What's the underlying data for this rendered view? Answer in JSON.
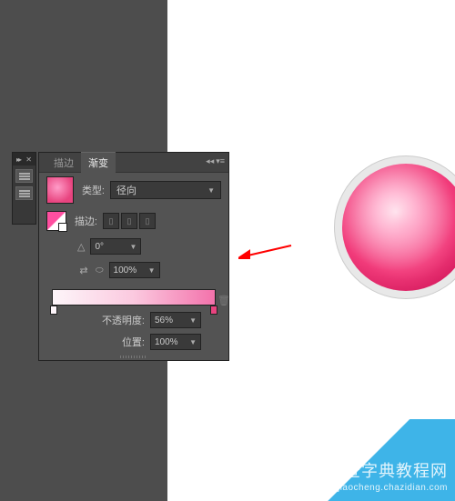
{
  "panel": {
    "tabs": {
      "stroke": "描边",
      "gradient": "渐变"
    },
    "type_label": "类型:",
    "type_value": "径向",
    "stroke_label": "描边:",
    "angle_value": "0°",
    "ratio_value": "100%",
    "opacity_label": "不透明度:",
    "opacity_value": "56%",
    "position_label": "位置:",
    "position_value": "100%"
  },
  "watermark": {
    "main": "查字典教程网",
    "sub": "jiaocheng.chazidian.com"
  },
  "chart_data": {
    "type": "gradient",
    "gradient_type": "radial",
    "angle": 0,
    "aspect_ratio": 100,
    "stops": [
      {
        "position": 0,
        "color": "#fdf5f9",
        "opacity": 56
      },
      {
        "position": 100,
        "color": "#e8447f",
        "opacity": 100
      }
    ]
  }
}
